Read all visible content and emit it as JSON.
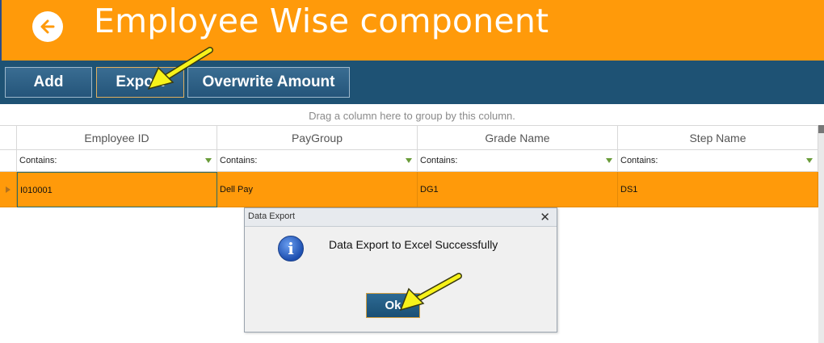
{
  "header": {
    "title": "Employee Wise component",
    "background": "#ff9a0a"
  },
  "toolbar": {
    "add_label": "Add",
    "export_label": "Export",
    "overwrite_label": "Overwrite Amount",
    "background": "#1e5274"
  },
  "grid": {
    "group_hint": "Drag a column here to group by this column.",
    "columns": [
      "Employee ID",
      "PayGroup",
      "Grade Name",
      "Step Name"
    ],
    "filter_label": "Contains:",
    "rows": [
      [
        "I010001",
        "Dell Pay",
        "DG1",
        "DS1"
      ]
    ],
    "selected_row_color": "#ff9a0a"
  },
  "dialog": {
    "title": "Data Export",
    "close_glyph": "✕",
    "icon_glyph": "i",
    "message": "Data Export to Excel Successfully",
    "ok_label": "Ok"
  },
  "icons": {
    "back": "arrow-left-circle-icon",
    "filter": "funnel-icon",
    "info": "info-icon",
    "annotation": "yellow-arrow-icon"
  }
}
